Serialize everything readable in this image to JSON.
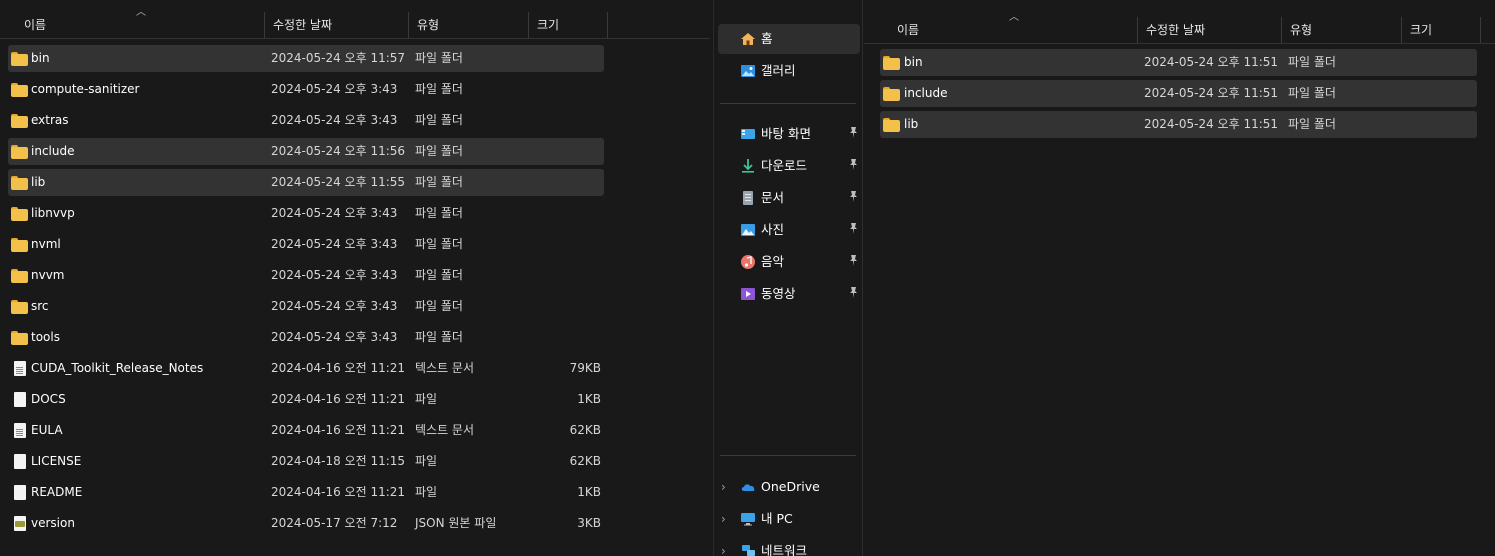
{
  "left_pane": {
    "columns": {
      "name": "이름",
      "modified": "수정한 날짜",
      "type": "유형",
      "size": "크기"
    },
    "rows": [
      {
        "name": "bin",
        "modified": "2024-05-24 오후 11:57",
        "type": "파일 폴더",
        "size": "",
        "icon": "folder-icon",
        "selected": true
      },
      {
        "name": "compute-sanitizer",
        "modified": "2024-05-24 오후 3:43",
        "type": "파일 폴더",
        "size": "",
        "icon": "folder-icon",
        "selected": false
      },
      {
        "name": "extras",
        "modified": "2024-05-24 오후 3:43",
        "type": "파일 폴더",
        "size": "",
        "icon": "folder-icon",
        "selected": false
      },
      {
        "name": "include",
        "modified": "2024-05-24 오후 11:56",
        "type": "파일 폴더",
        "size": "",
        "icon": "folder-icon",
        "selected": true
      },
      {
        "name": "lib",
        "modified": "2024-05-24 오후 11:55",
        "type": "파일 폴더",
        "size": "",
        "icon": "folder-icon",
        "selected": true
      },
      {
        "name": "libnvvp",
        "modified": "2024-05-24 오후 3:43",
        "type": "파일 폴더",
        "size": "",
        "icon": "folder-icon",
        "selected": false
      },
      {
        "name": "nvml",
        "modified": "2024-05-24 오후 3:43",
        "type": "파일 폴더",
        "size": "",
        "icon": "folder-icon",
        "selected": false
      },
      {
        "name": "nvvm",
        "modified": "2024-05-24 오후 3:43",
        "type": "파일 폴더",
        "size": "",
        "icon": "folder-icon",
        "selected": false
      },
      {
        "name": "src",
        "modified": "2024-05-24 오후 3:43",
        "type": "파일 폴더",
        "size": "",
        "icon": "folder-icon",
        "selected": false
      },
      {
        "name": "tools",
        "modified": "2024-05-24 오후 3:43",
        "type": "파일 폴더",
        "size": "",
        "icon": "folder-icon",
        "selected": false
      },
      {
        "name": "CUDA_Toolkit_Release_Notes",
        "modified": "2024-04-16 오전 11:21",
        "type": "텍스트 문서",
        "size": "79KB",
        "icon": "text-file-icon",
        "selected": false
      },
      {
        "name": "DOCS",
        "modified": "2024-04-16 오전 11:21",
        "type": "파일",
        "size": "1KB",
        "icon": "file-icon",
        "selected": false
      },
      {
        "name": "EULA",
        "modified": "2024-04-16 오전 11:21",
        "type": "텍스트 문서",
        "size": "62KB",
        "icon": "text-file-icon",
        "selected": false
      },
      {
        "name": "LICENSE",
        "modified": "2024-04-18 오전 11:15",
        "type": "파일",
        "size": "62KB",
        "icon": "file-icon",
        "selected": false
      },
      {
        "name": "README",
        "modified": "2024-04-16 오전 11:21",
        "type": "파일",
        "size": "1KB",
        "icon": "file-icon",
        "selected": false
      },
      {
        "name": "version",
        "modified": "2024-05-17 오전 7:12",
        "type": "JSON 원본 파일",
        "size": "3KB",
        "icon": "json-file-icon",
        "selected": false
      }
    ]
  },
  "right_pane": {
    "nav": {
      "quick": [
        {
          "label": "홈",
          "icon": "home-icon",
          "selected": true
        },
        {
          "label": "갤러리",
          "icon": "gallery-icon",
          "selected": false
        }
      ],
      "pinned": [
        {
          "label": "바탕 화면",
          "icon": "desktop-icon"
        },
        {
          "label": "다운로드",
          "icon": "download-icon"
        },
        {
          "label": "문서",
          "icon": "documents-icon"
        },
        {
          "label": "사진",
          "icon": "pictures-icon"
        },
        {
          "label": "음악",
          "icon": "music-icon"
        },
        {
          "label": "동영상",
          "icon": "videos-icon"
        }
      ],
      "locations": [
        {
          "label": "OneDrive",
          "icon": "onedrive-icon"
        },
        {
          "label": "내 PC",
          "icon": "this-pc-icon"
        },
        {
          "label": "네트워크",
          "icon": "network-icon"
        }
      ]
    },
    "columns": {
      "name": "이름",
      "modified": "수정한 날짜",
      "type": "유형",
      "size": "크기"
    },
    "rows": [
      {
        "name": "bin",
        "modified": "2024-05-24 오후 11:51",
        "type": "파일 폴더",
        "size": "",
        "icon": "folder-icon",
        "selected": true
      },
      {
        "name": "include",
        "modified": "2024-05-24 오후 11:51",
        "type": "파일 폴더",
        "size": "",
        "icon": "folder-icon",
        "selected": true
      },
      {
        "name": "lib",
        "modified": "2024-05-24 오후 11:51",
        "type": "파일 폴더",
        "size": "",
        "icon": "folder-icon",
        "selected": true
      }
    ]
  },
  "colors": {
    "background": "#191919",
    "selection": "#333333",
    "folder": "#f3c14a",
    "text": "#ffffff"
  }
}
